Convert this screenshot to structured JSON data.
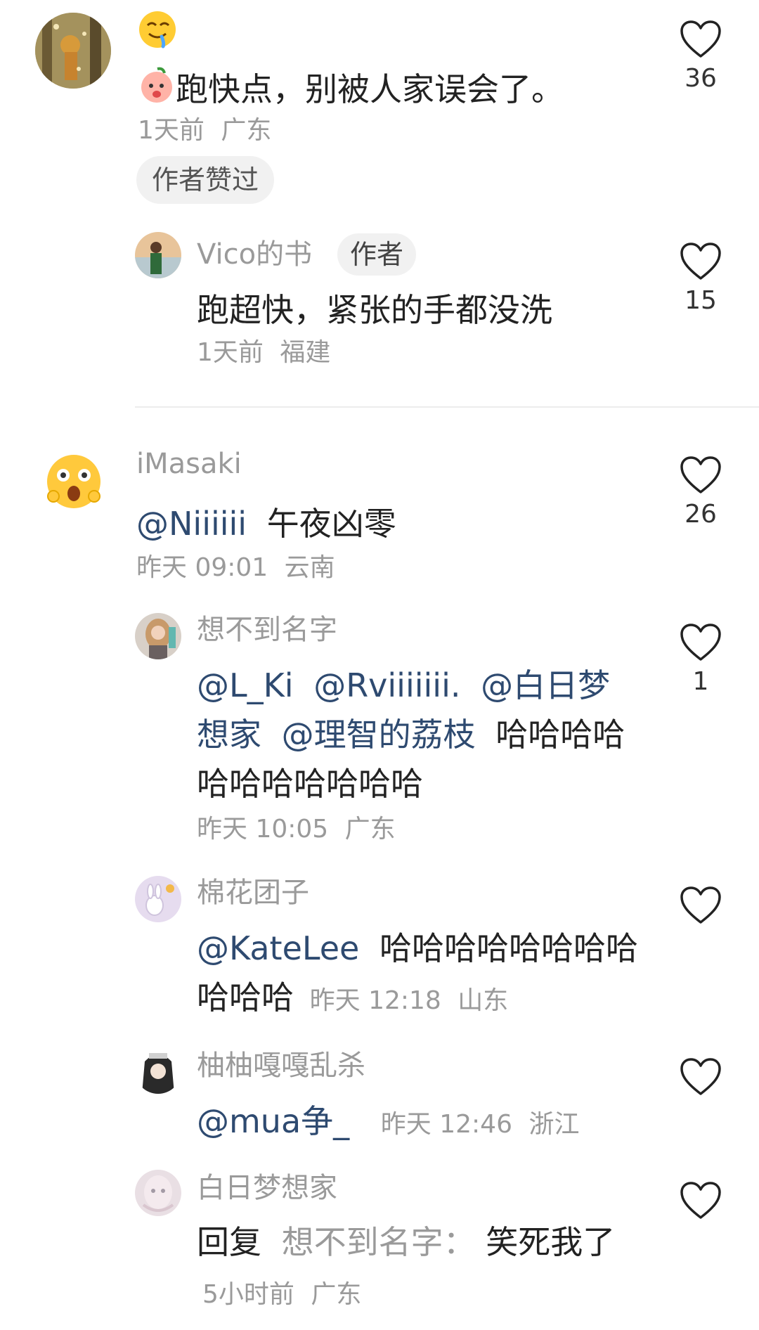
{
  "comments": [
    {
      "text": "跑快点，别被人家误会了。",
      "time": "1天前",
      "location": "广东",
      "author_liked_label": "作者赞过",
      "likes": "36",
      "reply": {
        "username": "Vico的书",
        "author_tag": "作者",
        "text": "跑超快，紧张的手都没洗",
        "time": "1天前",
        "location": "福建",
        "likes": "15"
      }
    },
    {
      "username": "iMasaki",
      "mention": "@Niiiiii",
      "text": "午夜凶零",
      "time": "昨天 09:01",
      "location": "云南",
      "likes": "26",
      "replies": [
        {
          "username": "想不到名字",
          "mentions": [
            "@L_Ki",
            "@Rviiiiiii.",
            "@白日梦想家",
            "@理智的荔枝"
          ],
          "text": "哈哈哈哈哈哈哈哈哈哈哈",
          "time": "昨天 10:05",
          "location": "广东",
          "likes": "1"
        },
        {
          "username": "棉花团子",
          "mention": "@KateLee",
          "text": "哈哈哈哈哈哈哈哈哈哈哈",
          "time": "昨天 12:18",
          "location": "山东",
          "likes": ""
        },
        {
          "username": "柚柚嘎嘎乱杀",
          "mention": "@mua争_",
          "time": "昨天 12:46",
          "location": "浙江",
          "likes": ""
        },
        {
          "username": "白日梦想家",
          "reply_prefix": "回复",
          "reply_to": "想不到名字：",
          "text": "笑死我了",
          "time": "5小时前",
          "location": "广东",
          "likes": ""
        }
      ]
    }
  ],
  "icons": {
    "like": "heart-outline-icon",
    "emoji_drool": "drooling-face-icon",
    "emoji_peach": "peach-character-icon",
    "emoji_surprised": "surprised-face-icon"
  },
  "colors": {
    "mention": "#2e4a70",
    "secondary_text": "#9a9a9a",
    "divider": "#ececec"
  }
}
